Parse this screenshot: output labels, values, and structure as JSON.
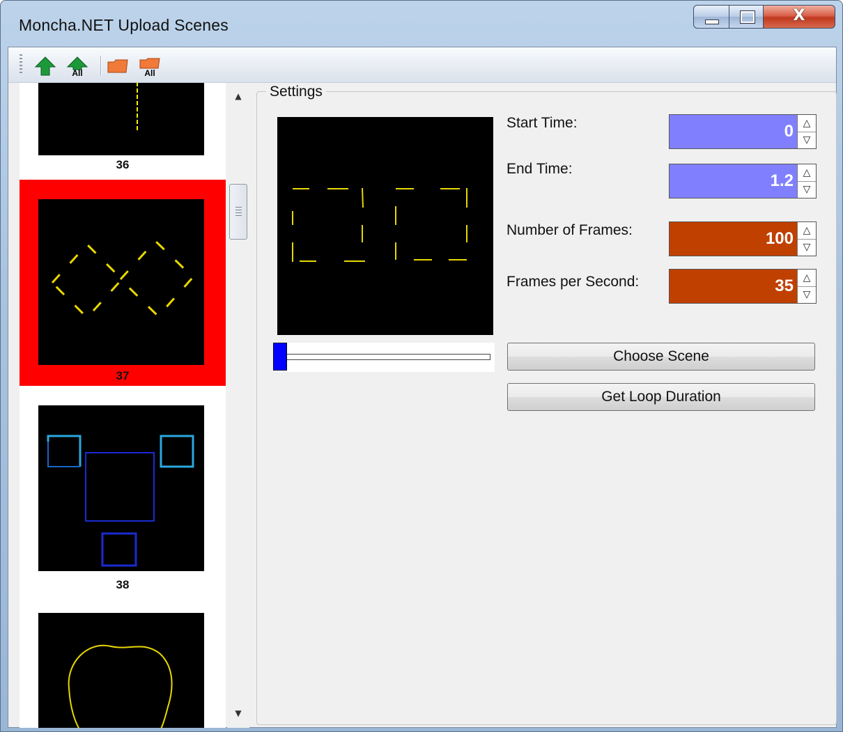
{
  "window": {
    "title": "Moncha.NET Upload Scenes"
  },
  "toolbar": {
    "items": [
      {
        "name": "upload-icon",
        "label": ""
      },
      {
        "name": "upload-all-icon",
        "label": "All"
      },
      {
        "name": "folder-icon",
        "label": ""
      },
      {
        "name": "folder-all-icon",
        "label": "All"
      }
    ]
  },
  "thumbnails": [
    {
      "label": "36",
      "selected": false
    },
    {
      "label": "37",
      "selected": true
    },
    {
      "label": "38",
      "selected": false
    },
    {
      "label": "",
      "selected": false
    }
  ],
  "settings": {
    "group_title": "Settings",
    "start_time_label": "Start Time:",
    "start_time_value": "0",
    "end_time_label": "End Time:",
    "end_time_value": "1.2",
    "frames_label": "Number of Frames:",
    "frames_value": "100",
    "fps_label": "Frames per Second:",
    "fps_value": "35",
    "choose_scene_label": "Choose Scene",
    "loop_duration_label": "Get Loop Duration",
    "slider_position": 0
  },
  "colors": {
    "time_field": "#8080ff",
    "frames_field": "#c04000",
    "selection": "#ff0000",
    "slider_thumb": "#0000ff"
  }
}
